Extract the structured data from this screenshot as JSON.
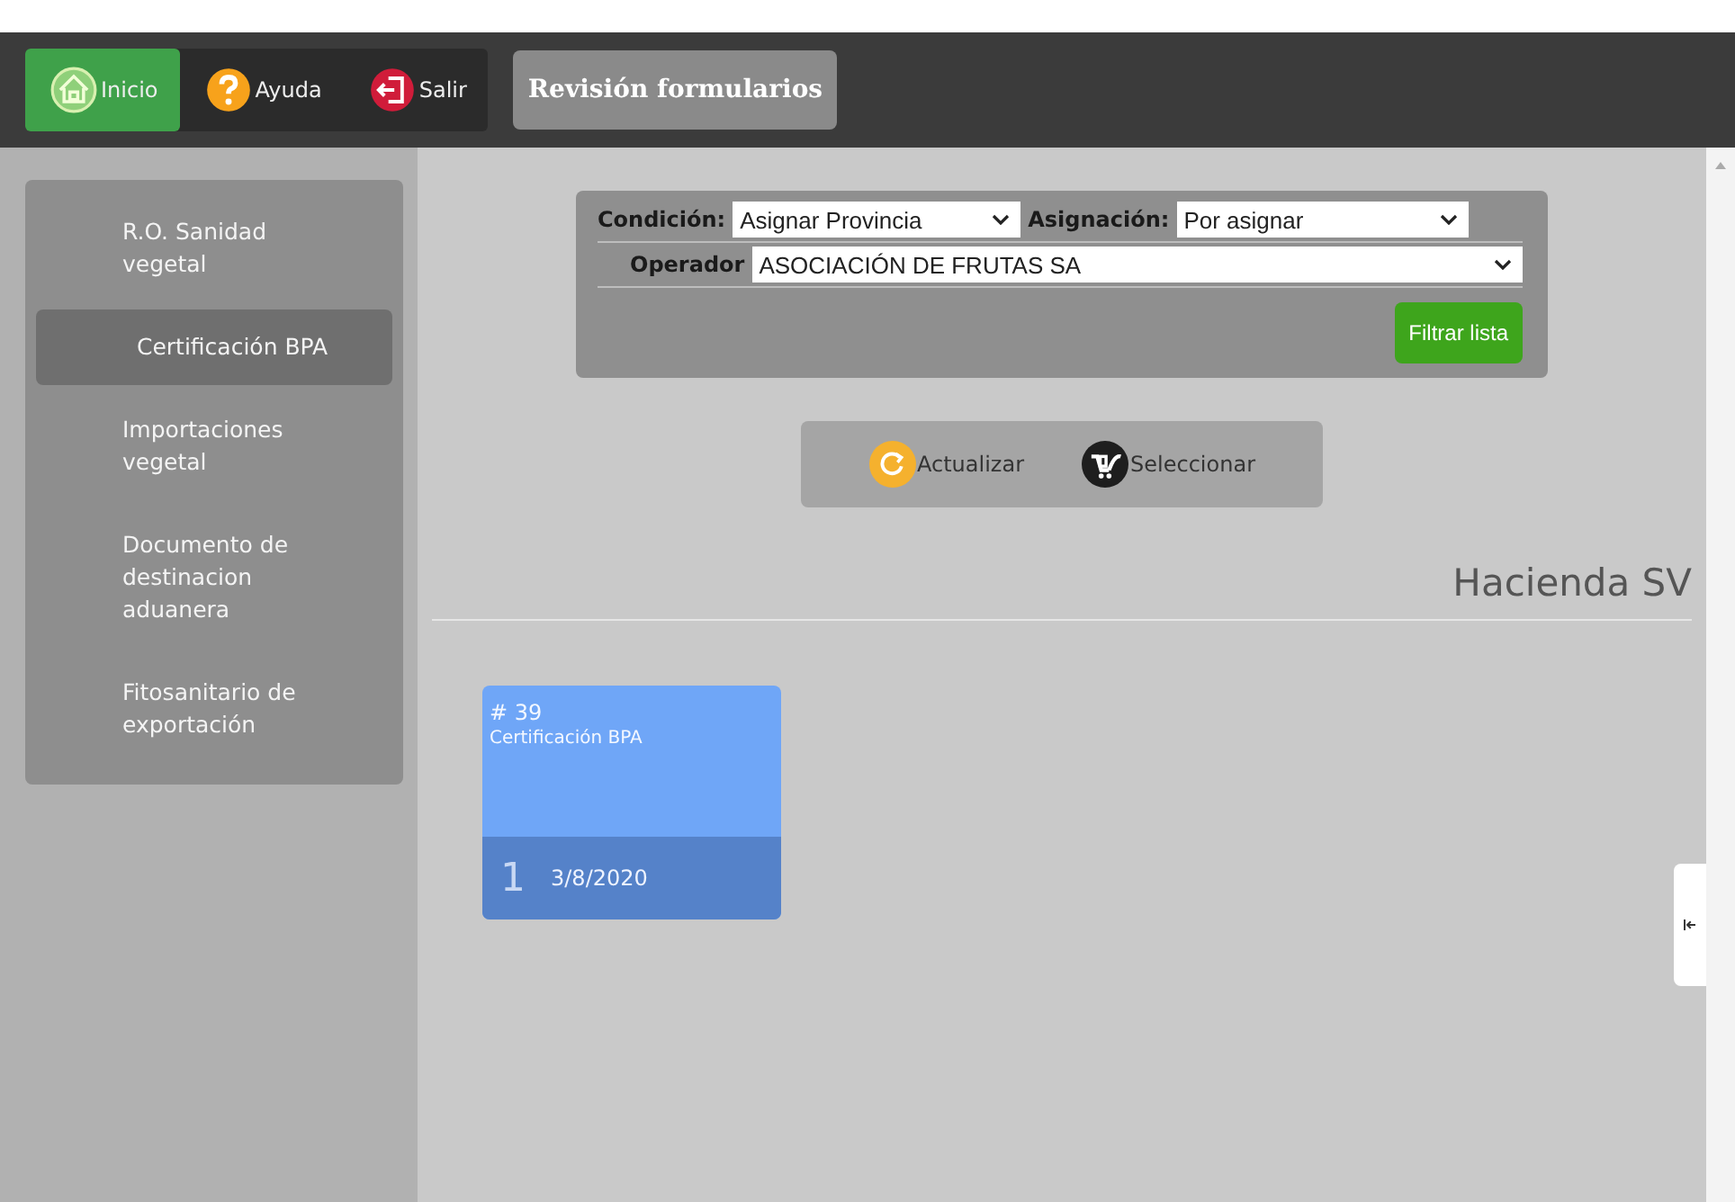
{
  "nav": [
    {
      "label": "Inicio",
      "kind": "home",
      "selected": true
    },
    {
      "label": "Ayuda",
      "kind": "help",
      "selected": false
    },
    {
      "label": "Salir",
      "kind": "exit",
      "selected": false
    }
  ],
  "page_button": "Revisión formularios",
  "sidebar": {
    "items": [
      {
        "label": "R.O. Sanidad vegetal",
        "selected": false
      },
      {
        "label": "Certificación BPA",
        "selected": true
      },
      {
        "label": "Importaciones vegetal",
        "selected": false
      },
      {
        "label": "Documento de destinacion aduanera",
        "selected": false
      },
      {
        "label": "Fitosanitario de exportación",
        "selected": false
      }
    ]
  },
  "filter": {
    "condicion": {
      "label": "Condición:",
      "value": "Asignar Provincia"
    },
    "asignacion": {
      "label": "Asignación:",
      "value": "Por asignar"
    },
    "operador": {
      "label": "Operador",
      "value": "ASOCIACIÓN DE FRUTAS SA"
    },
    "button": "Filtrar lista"
  },
  "actions": [
    {
      "label": "Actualizar",
      "kind": "refresh"
    },
    {
      "label": "Seleccionar",
      "kind": "select"
    }
  ],
  "section_title": "Hacienda SV",
  "cards": [
    {
      "number": "# 39",
      "title": "Certificación BPA",
      "count": "1",
      "date": "3/8/2020"
    }
  ]
}
